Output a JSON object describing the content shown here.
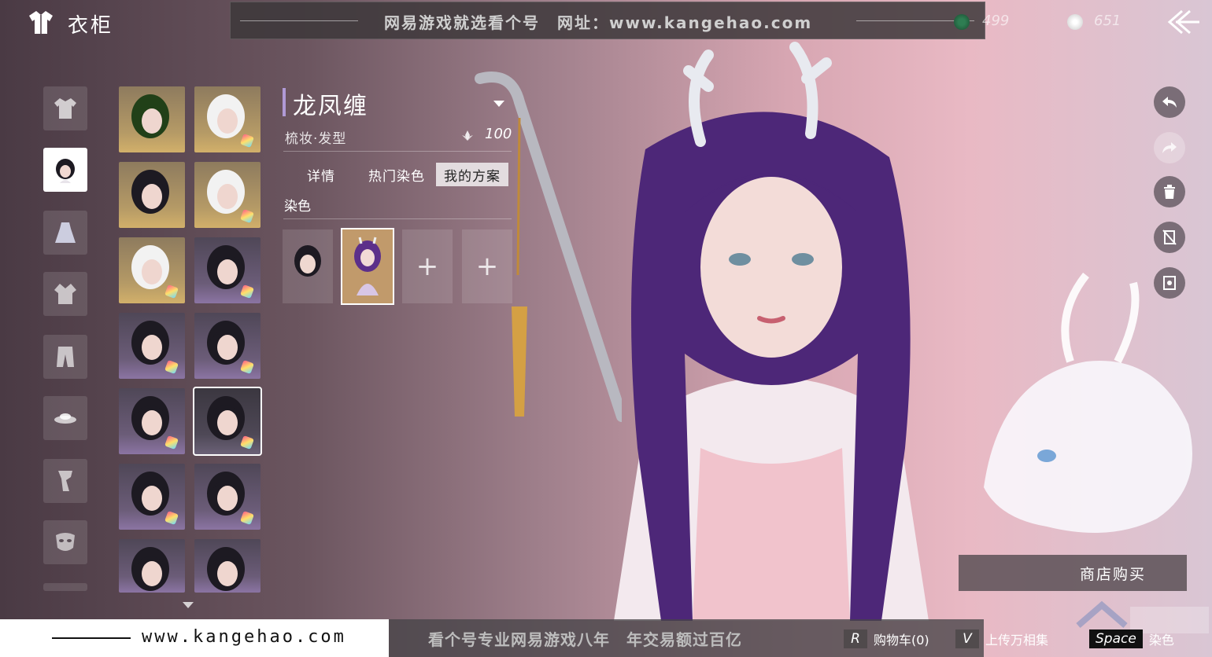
{
  "header": {
    "title": "衣柜",
    "banner_text": "网易游戏就选看个号　网址：www.kangehao.com",
    "currency_green": "499",
    "currency_pearl": "651"
  },
  "categories": [
    {
      "name": "top-garment"
    },
    {
      "name": "hairstyle",
      "active": true
    },
    {
      "name": "dress"
    },
    {
      "name": "jacket"
    },
    {
      "name": "pants"
    },
    {
      "name": "hat"
    },
    {
      "name": "scarf"
    },
    {
      "name": "mask"
    }
  ],
  "hair_grid": [
    {
      "style": "gold"
    },
    {
      "style": "gold",
      "dye": true
    },
    {
      "style": "gold"
    },
    {
      "style": "gold",
      "dye": true
    },
    {
      "style": "gold",
      "dye": true
    },
    {
      "style": "purple",
      "dye": true
    },
    {
      "style": "purple",
      "dye": true
    },
    {
      "style": "purple",
      "dye": true
    },
    {
      "style": "purple",
      "dye": true
    },
    {
      "style": "dark",
      "dye": true,
      "selected": true
    },
    {
      "style": "purple",
      "dye": true
    },
    {
      "style": "purple",
      "dye": true
    },
    {
      "style": "purple"
    },
    {
      "style": "purple"
    }
  ],
  "detail": {
    "name": "龙凤缠",
    "type": "梳妆·发型",
    "points": "100",
    "tabs": [
      "详情",
      "热门染色",
      "我的方案"
    ],
    "active_tab": 2,
    "section_label": "染色",
    "add_symbol": "+"
  },
  "actions": {
    "buy_label": "商店购买"
  },
  "bottom": {
    "url": "www.kangehao.com",
    "slogan": "看个号专业网易游戏八年　年交易额过百亿",
    "cart_key": "R",
    "cart_label": "购物车(0)",
    "album_key": "V",
    "album_label": "上传万相集",
    "dye_key": "Space",
    "dye_label": "染色"
  },
  "colors": {
    "accent": "#b09ad6",
    "tab_active_bg": "#e3dcdf",
    "slot_selected": "#c19a6b"
  }
}
